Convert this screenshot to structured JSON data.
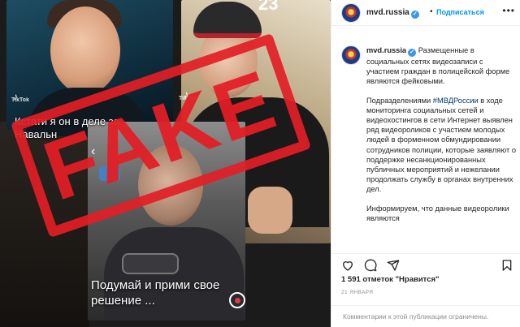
{
  "media": {
    "stamp_text": "FAKE",
    "counter": "23",
    "tiktok_label": "TikTok",
    "caption_left": "Кстати я он в деле за Навальн",
    "caption_main": "Подумай и прими свое решение ..."
  },
  "post": {
    "username": "mvd.russia",
    "follow_label": "Подписаться",
    "dot": "•",
    "more": "•••",
    "verified_icon": "✓",
    "caption_p1": "Размещенные в социальных сетях видеозаписи с участием граждан в полицейской форме являются фейковыми.",
    "caption_p2_before": "Подразделениями ",
    "hashtag": "#МВДРоссии",
    "caption_p2_after": " в ходе мониторинга социальных сетей и видеохостингов в сети Интернет выявлен ряд видеороликов с участием молодых людей в форменном обмундировании сотрудников полиции, которые заявляют о поддержке несанкционированных публичных мероприятий и нежелании продолжать службу в органах внутренних дел.",
    "caption_p3": "Информируем, что данные видеоролики являются",
    "likes": "1 591 отметок \"Нравится\"",
    "date": "21 ЯНВАРЯ",
    "comments_restricted": "Комментарии к этой публикации ограничены."
  },
  "icons": [
    "heart-icon",
    "comment-icon",
    "share-icon",
    "bookmark-icon",
    "verified-icon",
    "more-icon"
  ],
  "colors": {
    "accent": "#0095f6",
    "stamp": "#e21e25",
    "text": "#262626",
    "muted": "#8e8e8e"
  }
}
